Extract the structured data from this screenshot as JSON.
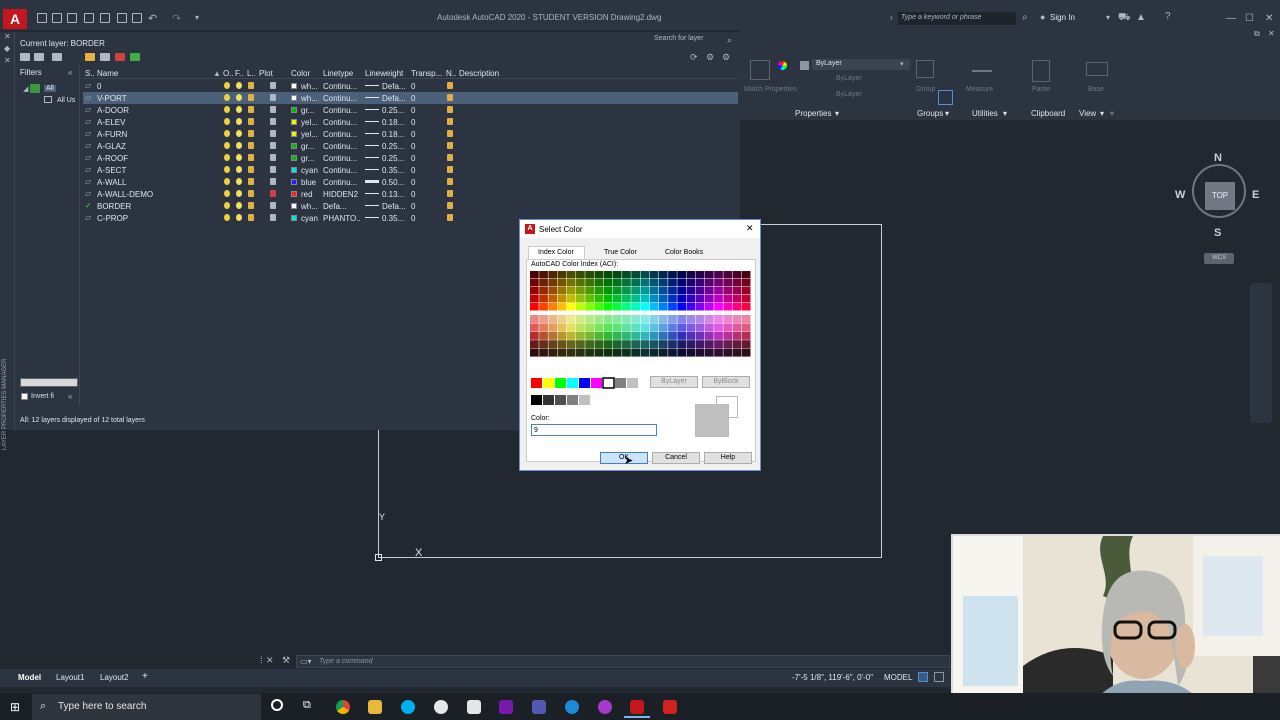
{
  "titlebar": {
    "title": "Autodesk AutoCAD 2020 - STUDENT VERSION    Drawing2.dwg",
    "search_placeholder": "Type a keyword or phrase",
    "signin_label": "Sign In"
  },
  "layer_manager": {
    "current_layer": "Current layer: BORDER",
    "search_placeholder": "Search for layer",
    "filters_label": "Filters",
    "filter_tree": [
      "All",
      "All Us"
    ],
    "columns": [
      "S..",
      "Name",
      "O..",
      "F..",
      "L..",
      "Plot",
      "Color",
      "Linetype",
      "Lineweight",
      "Transp...",
      "N..",
      "Description"
    ],
    "layers": [
      {
        "name": "0",
        "color_name": "wh...",
        "color": "#ffffff",
        "linetype": "Continu...",
        "lineweight": "Defa...",
        "transp": "0",
        "lw_thick": false,
        "selected": false,
        "current": false
      },
      {
        "name": "V-PORT",
        "color_name": "wh...",
        "color": "#ffffff",
        "linetype": "Continu...",
        "lineweight": "Defa...",
        "transp": "0",
        "lw_thick": false,
        "selected": true,
        "current": false
      },
      {
        "name": "A-DOOR",
        "color_name": "gr...",
        "color": "#00c000",
        "linetype": "Continu...",
        "lineweight": "0.25...",
        "transp": "0",
        "lw_thick": false,
        "selected": false,
        "current": false
      },
      {
        "name": "A-ELEV",
        "color_name": "yel...",
        "color": "#f0f000",
        "linetype": "Continu...",
        "lineweight": "0.18...",
        "transp": "0",
        "lw_thick": false,
        "selected": false,
        "current": false
      },
      {
        "name": "A-FURN",
        "color_name": "yel...",
        "color": "#f0f000",
        "linetype": "Continu...",
        "lineweight": "0.18...",
        "transp": "0",
        "lw_thick": false,
        "selected": false,
        "current": false
      },
      {
        "name": "A-GLAZ",
        "color_name": "gr...",
        "color": "#00c000",
        "linetype": "Continu...",
        "lineweight": "0.25...",
        "transp": "0",
        "lw_thick": false,
        "selected": false,
        "current": false
      },
      {
        "name": "A-ROOF",
        "color_name": "gr...",
        "color": "#00c000",
        "linetype": "Continu...",
        "lineweight": "0.25...",
        "transp": "0",
        "lw_thick": false,
        "selected": false,
        "current": false
      },
      {
        "name": "A-SECT",
        "color_name": "cyan",
        "color": "#00e0e0",
        "linetype": "Continu...",
        "lineweight": "0.35...",
        "transp": "0",
        "lw_thick": false,
        "selected": false,
        "current": false
      },
      {
        "name": "A-WALL",
        "color_name": "blue",
        "color": "#2020ff",
        "linetype": "Continu...",
        "lineweight": "0.50...",
        "transp": "0",
        "lw_thick": true,
        "selected": false,
        "current": false
      },
      {
        "name": "A-WALL-DEMO",
        "color_name": "red",
        "color": "#ff2020",
        "linetype": "HIDDEN2",
        "lineweight": "0.13...",
        "transp": "0",
        "lw_thick": false,
        "selected": false,
        "current": false
      },
      {
        "name": "BORDER",
        "color_name": "wh...",
        "color": "#ffffff",
        "linetype": "Defa...",
        "lineweight": "Defa...",
        "transp": "0",
        "lw_thick": false,
        "selected": false,
        "current": true
      },
      {
        "name": "C-PROP",
        "color_name": "cyan",
        "color": "#00e0e0",
        "linetype": "PHANTO...",
        "lineweight": "0.35...",
        "transp": "0",
        "lw_thick": false,
        "selected": false,
        "current": false
      }
    ],
    "invert_label": "Invert fi",
    "status": "All: 12 layers displayed of 12 total layers",
    "side_title": "LAYER PROPERTIES MANAGER"
  },
  "ribbon": {
    "bylayer_1": "ByLayer",
    "bylayer_2": "ByLayer",
    "bylayer_3": "ByLayer",
    "match_label": "Match Properties",
    "group_label": "Group",
    "measure_label": "Measure",
    "paste_label": "Paste",
    "base_label": "Base",
    "panels": [
      "Properties",
      "Groups",
      "Utilities",
      "Clipboard",
      "View"
    ]
  },
  "viewcube": {
    "n": "N",
    "s": "S",
    "e": "E",
    "w": "W",
    "face": "TOP",
    "wcs": "WCS"
  },
  "ucs": {
    "y": "Y",
    "x": "X"
  },
  "dialog": {
    "title": "Select Color",
    "tabs": [
      "Index Color",
      "True Color",
      "Color Books"
    ],
    "aci_label": "AutoCAD Color Index (ACI):",
    "bylayer_btn": "ByLayer",
    "byblock_btn": "ByBlock",
    "color_label": "Color:",
    "color_value": "9",
    "ok_label": "OK",
    "cancel_label": "Cancel",
    "help_label": "Help",
    "preview_color": "#c0c0c0"
  },
  "commandline": {
    "placeholder": "Type a command"
  },
  "statusbar": {
    "coords": "-7'-5 1/8\", 119'-6\", 0'-0\"",
    "model": "MODEL"
  },
  "layout_tabs": [
    "Model",
    "Layout1",
    "Layout2"
  ],
  "taskbar": {
    "search_placeholder": "Type here to search"
  }
}
